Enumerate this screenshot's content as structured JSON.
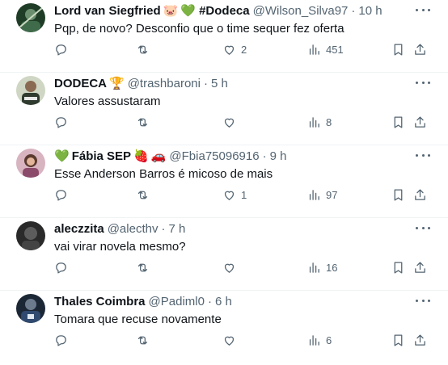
{
  "tweets": [
    {
      "name": "Lord van Siegfried",
      "emojis": [
        "🐷",
        "💚"
      ],
      "name_suffix": "#Dodeca",
      "handle": "@Wilson_Silva97",
      "time": "10 h",
      "text": "Pqp, de novo? Desconfio que o time sequer fez oferta",
      "likes": "2",
      "views": "451",
      "avatar_color": "#2f5d3a"
    },
    {
      "name": "DODECA",
      "emojis": [
        "🏆"
      ],
      "name_suffix": "",
      "handle": "@trashbaroni",
      "time": "5 h",
      "text": "Valores assustaram",
      "likes": "",
      "views": "8",
      "avatar_color": "#9aa88c"
    },
    {
      "name": "Fábia SEP",
      "emojis_before": [
        "💚"
      ],
      "emojis": [
        "🍓",
        "🚗"
      ],
      "name_suffix": "",
      "handle": "@Fbia75096916",
      "time": "9 h",
      "text": "Esse Anderson Barros é micoso de mais",
      "likes": "1",
      "views": "97",
      "avatar_color": "#b5728a"
    },
    {
      "name": "aleczzita",
      "emojis": [],
      "name_suffix": "",
      "handle": "@alecthv",
      "time": "7 h",
      "text": "vai virar novela mesmo?",
      "likes": "",
      "views": "16",
      "avatar_color": "#3a3a3a"
    },
    {
      "name": "Thales Coimbra",
      "emojis": [],
      "name_suffix": "",
      "handle": "@Padiml0",
      "time": "6 h",
      "text": "Tomara que recuse novamente",
      "likes": "",
      "views": "6",
      "avatar_color": "#2d3b4f"
    }
  ]
}
